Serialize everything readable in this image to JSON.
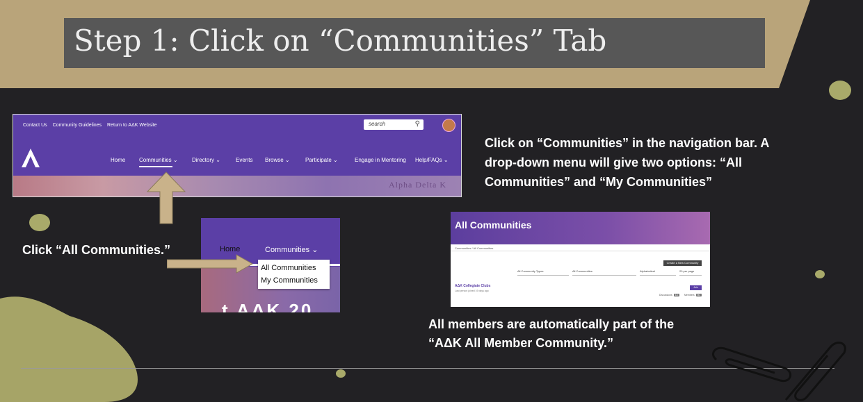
{
  "slide": {
    "title": "Step 1: Click on “Communities” Tab",
    "instruction": [
      "Click on “Communities” in the navigation bar.  A",
      "drop-down menu will give two options: “All",
      "Communities” and “My Communities”"
    ],
    "click_all_label": "Click “All Communities.”",
    "auto_member_note": [
      "All members are automatically part of the",
      "“AΔK All Member Community.”"
    ]
  },
  "navbar_shot": {
    "top_links": [
      "Contact Us",
      "Community Guidelines",
      "Return to AΔK Website"
    ],
    "search_placeholder": "search",
    "nav_items": [
      "Home",
      "Communities ⌄",
      "Directory ⌄",
      "Events",
      "Browse ⌄",
      "Participate ⌄",
      "Engage in Mentoring",
      "Help/FAQs ⌄"
    ],
    "banner_text": "Alpha Delta K"
  },
  "dropdown_shot": {
    "home": "Home",
    "communities": "Communities ⌄",
    "options": [
      "All Communities",
      "My Communities"
    ],
    "watermark": "t AΔK 20"
  },
  "communities_shot": {
    "title": "All Communities",
    "breadcrumb": "Communities / All Communities",
    "create_button": "Create a New Community",
    "filters": [
      "All Community Types",
      "All Communities",
      "Alphabetical",
      "20 per page"
    ],
    "community_name": "AΔK Collegiate Clubs",
    "community_meta": "Last person joined 19 days ago",
    "join_button": "Join",
    "discussions_label": "Discussions",
    "discussions_count": "13",
    "members_label": "Members",
    "members_count": "50"
  },
  "colors": {
    "background": "#222124",
    "tan": "#b9a47a",
    "title_box": "#575757",
    "purple": "#5b3fa6",
    "olive_dot": "#a9aa6a",
    "arrow": "#c9b28a"
  }
}
